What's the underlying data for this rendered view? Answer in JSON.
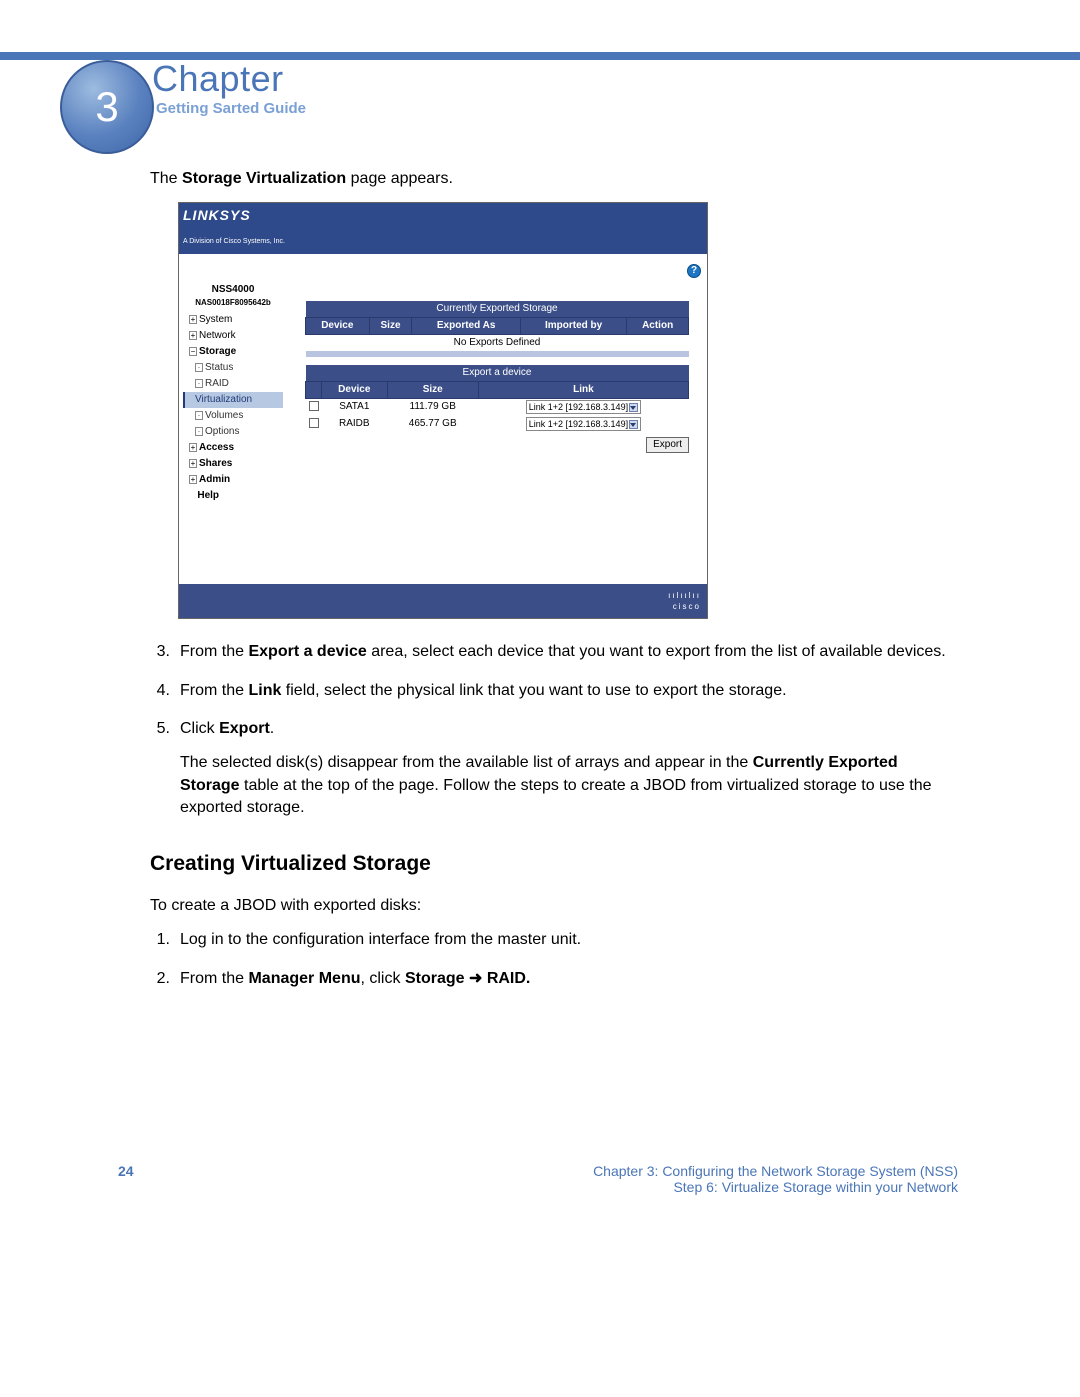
{
  "header": {
    "chapter_num": "3",
    "chapter_word": "Chapter",
    "guide": "Getting Sarted Guide"
  },
  "intro_pre": "The ",
  "intro_bold": "Storage Virtualization",
  "intro_post": " page appears.",
  "screenshot": {
    "brand": "LINKSYS",
    "brand_tag": "A Division of Cisco Systems, Inc.",
    "help_glyph": "?",
    "device_name": "NSS4000",
    "mac": "NAS0018F8095642b",
    "nav": {
      "system": "System",
      "network": "Network",
      "storage": "Storage",
      "status": "Status",
      "raid": "RAID",
      "virtualization": "Virtualization",
      "volumes": "Volumes",
      "options": "Options",
      "access": "Access",
      "shares": "Shares",
      "admin": "Admin",
      "help": "Help"
    },
    "exported": {
      "title": "Currently Exported Storage",
      "cols": {
        "device": "Device",
        "size": "Size",
        "exported_as": "Exported As",
        "imported_by": "Imported by",
        "action": "Action"
      },
      "empty": "No Exports Defined"
    },
    "export_sec": {
      "title": "Export a device",
      "cols": {
        "device": "Device",
        "size": "Size",
        "link": "Link"
      },
      "row1": {
        "device": "SATA1",
        "size": "111.79 GB",
        "link": "Link 1+2 [192.168.3.149]"
      },
      "row2": {
        "device": "RAIDB",
        "size": "465.77 GB",
        "link": "Link 1+2 [192.168.3.149]"
      },
      "export_btn": "Export"
    },
    "cisco": "cisco"
  },
  "steps_a": {
    "s3": {
      "num": "3.",
      "pre": "From the ",
      "b1": "Export a device",
      "post": " area, select each device that you want to export from the list of available devices."
    },
    "s4": {
      "num": "4.",
      "pre": "From the ",
      "b1": "Link",
      "post": " field, select the physical link that you want to use to export the storage."
    },
    "s5": {
      "num": "5.",
      "pre": "Click ",
      "b1": "Export",
      "post": ".",
      "p2_pre": "The selected disk(s) disappear from the available list of arrays and appear in the ",
      "p2_b": "Currently Exported Storage",
      "p2_post": " table at the top of the page. Follow the steps to create a JBOD from virtualized storage to use the exported storage."
    }
  },
  "heading2": "Creating Virtualized Storage",
  "intro2": "To create a JBOD with exported disks:",
  "steps_b": {
    "s1": {
      "num": "1.",
      "text": "Log in to the configuration interface from the master unit."
    },
    "s2": {
      "num": "2.",
      "pre": "From the ",
      "b1": "Manager Menu",
      "mid": ", click ",
      "b2": "Storage",
      "arrow": "  ➜  ",
      "b3": "RAID."
    }
  },
  "footer": {
    "page": "24",
    "line1": "Chapter 3: Configuring the Network Storage System (NSS)",
    "line2": "Step 6: Virtualize Storage within your Network"
  }
}
